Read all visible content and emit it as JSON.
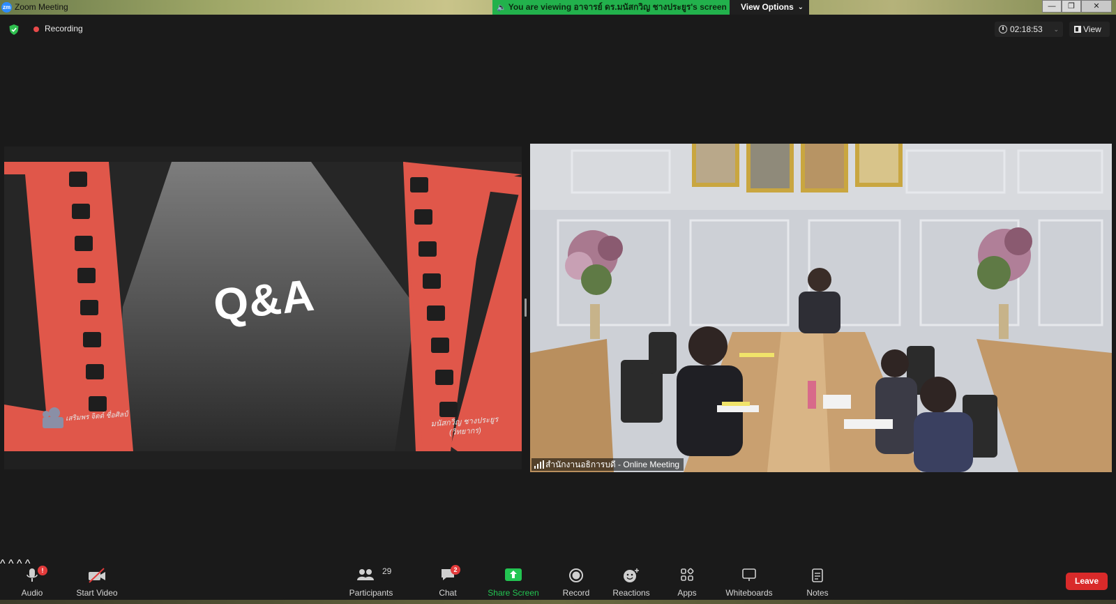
{
  "window": {
    "app_logo": "zm",
    "title": "Zoom Meeting",
    "banner_text": "You are viewing อาจารย์ ดร.มนัสกวิญ ชางประยูร's screen",
    "view_options_label": "View Options",
    "min_glyph": "—",
    "max_glyph": "❐",
    "close_glyph": "✕"
  },
  "header": {
    "recording_label": "Recording",
    "timer": "02:18:53",
    "view_label": "View"
  },
  "shared_screen": {
    "slide_title": "Q&A",
    "signature_left": "เสริมพร จิตต์ ชื่อศิลป์",
    "signature_right_line1": "มนัสกวิญ ชางประยูร",
    "signature_right_line2": "(วิทยากร)"
  },
  "video": {
    "participant_name": "สำนักงานอธิการบดี - Online Meeting"
  },
  "toolbar": {
    "audio_label": "Audio",
    "audio_badge": "!",
    "start_video_label": "Start Video",
    "participants_label": "Participants",
    "participants_count": "29",
    "chat_label": "Chat",
    "chat_badge": "2",
    "share_label": "Share Screen",
    "record_label": "Record",
    "reactions_label": "Reactions",
    "apps_label": "Apps",
    "whiteboards_label": "Whiteboards",
    "notes_label": "Notes",
    "leave_label": "Leave"
  },
  "colors": {
    "background": "#1a1a1a",
    "banner_green": "#22b14c",
    "share_green": "#23c552",
    "leave_red": "#d92a2a",
    "film_orange": "#e0574a",
    "record_dot": "#e84a4a"
  }
}
